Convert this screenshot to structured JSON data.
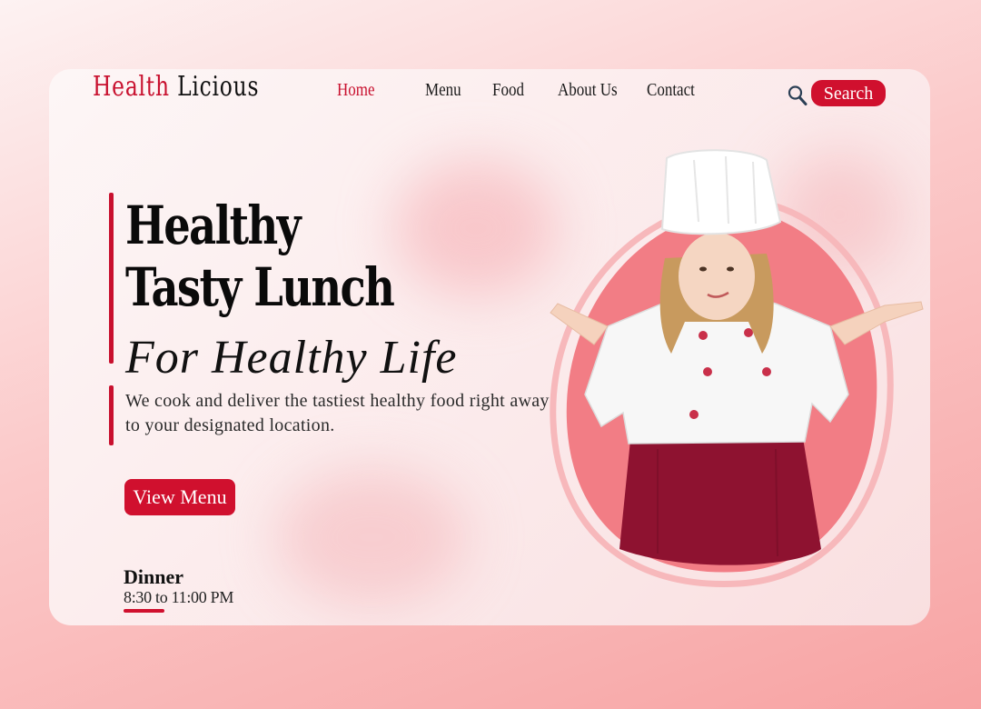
{
  "brand": {
    "part1": "Health",
    "part2": "Licious"
  },
  "nav": {
    "items": [
      {
        "label": "Home",
        "active": true
      },
      {
        "label": "Menu"
      },
      {
        "label": "Food"
      },
      {
        "label": "About Us"
      },
      {
        "label": "Contact"
      }
    ]
  },
  "search": {
    "label": "Search",
    "icon": "search-icon"
  },
  "hero": {
    "headline_line1": "Healthy",
    "headline_line2": "Tasty Lunch",
    "tagline": "For Healthy Life",
    "description": "We cook and deliver the tastiest healthy food right away to your designated location.",
    "cta_label": "View Menu"
  },
  "hours": {
    "title": "Dinner",
    "time": "8:30 to 11:00 PM"
  },
  "colors": {
    "accent": "#d0102e",
    "blob": "#f27d85",
    "apron": "#8e1230"
  }
}
